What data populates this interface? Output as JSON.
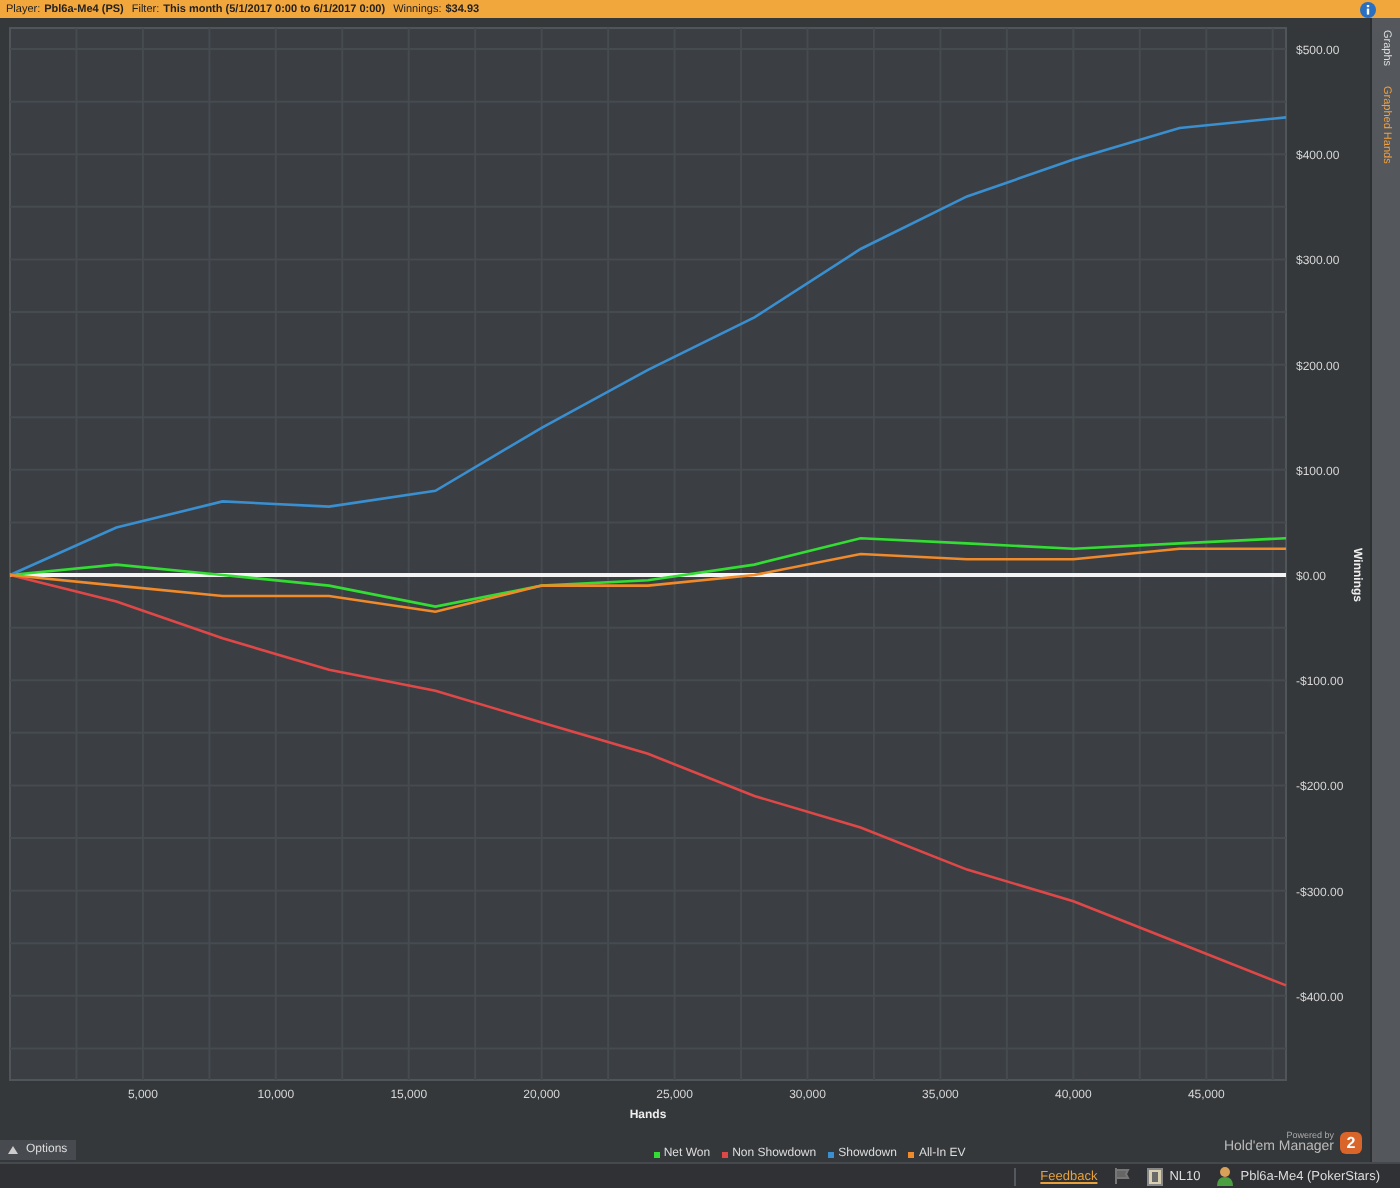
{
  "top_bar": {
    "player_label": "Player:",
    "player": "Pbl6a-Me4 (PS)",
    "filter_label": "Filter:",
    "filter": "This month (5/1/2017 0:00 to 6/1/2017 0:00)",
    "winnings_label": "Winnings:",
    "winnings": "$34.93"
  },
  "side_tabs": [
    {
      "label": "Graphs",
      "selected": false
    },
    {
      "label": "Graphed Hands",
      "selected": true
    }
  ],
  "chart": {
    "chart_data": {
      "type": "line",
      "xlabel": "Hands",
      "ylabel": "Winnings",
      "x": [
        0,
        4000,
        8000,
        12000,
        16000,
        20000,
        24000,
        28000,
        32000,
        36000,
        40000,
        44000,
        48000
      ],
      "series": [
        {
          "name": "Net Won",
          "color": "#33dd33",
          "values": [
            0,
            10,
            0,
            -10,
            -30,
            -10,
            -5,
            10,
            35,
            30,
            25,
            30,
            35
          ]
        },
        {
          "name": "Non Showdown",
          "color": "#e04848",
          "values": [
            0,
            -25,
            -60,
            -90,
            -110,
            -140,
            -170,
            -210,
            -240,
            -280,
            -310,
            -350,
            -390
          ]
        },
        {
          "name": "Showdown",
          "color": "#3a8fd0",
          "values": [
            0,
            45,
            70,
            65,
            80,
            140,
            195,
            245,
            310,
            360,
            395,
            425,
            435
          ]
        },
        {
          "name": "All-In EV",
          "color": "#f08a2a",
          "values": [
            0,
            -10,
            -20,
            -20,
            -35,
            -10,
            -10,
            0,
            20,
            15,
            15,
            25,
            25
          ]
        }
      ],
      "grid": true,
      "xlim": [
        0,
        48000
      ],
      "ylim": [
        -480,
        520
      ],
      "xticks": [
        {
          "value": 5000,
          "label": "5,000"
        },
        {
          "value": 10000,
          "label": "10,000"
        },
        {
          "value": 15000,
          "label": "15,000"
        },
        {
          "value": 20000,
          "label": "20,000"
        },
        {
          "value": 25000,
          "label": "25,000"
        },
        {
          "value": 30000,
          "label": "30,000"
        },
        {
          "value": 35000,
          "label": "35,000"
        },
        {
          "value": 40000,
          "label": "40,000"
        },
        {
          "value": 45000,
          "label": "45,000"
        }
      ],
      "yticks": [
        {
          "value": 500,
          "label": "$500.00"
        },
        {
          "value": 400,
          "label": "$400.00"
        },
        {
          "value": 300,
          "label": "$300.00"
        },
        {
          "value": 200,
          "label": "$200.00"
        },
        {
          "value": 100,
          "label": "$100.00"
        },
        {
          "value": 0,
          "label": "$0.00"
        },
        {
          "value": -100,
          "label": "-$100.00"
        },
        {
          "value": -200,
          "label": "-$200.00"
        },
        {
          "value": -300,
          "label": "-$300.00"
        },
        {
          "value": -400,
          "label": "-$400.00"
        }
      ]
    }
  },
  "options_button": "Options",
  "branding": {
    "powered_by": "Powered by",
    "product": "Hold'em Manager",
    "badge": "2"
  },
  "status_bar": {
    "feedback": "Feedback",
    "stake": "NL10",
    "account": "Pbl6a-Me4 (PokerStars)"
  }
}
